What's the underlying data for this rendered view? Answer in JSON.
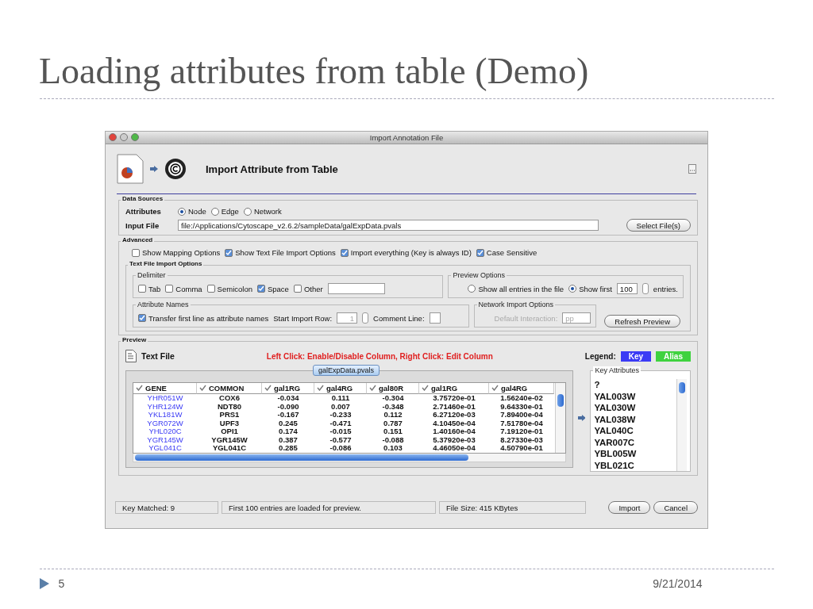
{
  "slide": {
    "title": "Loading attributes from table (Demo)",
    "page_number": "5",
    "date": "9/21/2014"
  },
  "window": {
    "title": "Import Annotation File"
  },
  "header": {
    "title": "Import Attribute from Table"
  },
  "data_sources": {
    "label": "Data Sources",
    "attributes_label": "Attributes",
    "attribute_types": [
      {
        "label": "Node",
        "selected": true
      },
      {
        "label": "Edge",
        "selected": false
      },
      {
        "label": "Network",
        "selected": false
      }
    ],
    "input_file_label": "Input File",
    "input_file": "file:/Applications/Cytoscape_v2.6.2/sampleData/galExpData.pvals",
    "select_button": "Select File(s)"
  },
  "advanced": {
    "label": "Advanced",
    "options": [
      {
        "label": "Show Mapping Options",
        "checked": false
      },
      {
        "label": "Show Text File Import Options",
        "checked": true
      },
      {
        "label": "Import everything (Key is always ID)",
        "checked": true
      },
      {
        "label": "Case Sensitive",
        "checked": true
      }
    ],
    "text_file_import_options": {
      "label": "Text File Import Options",
      "delimiter": {
        "label": "Delimiter",
        "options": [
          {
            "label": "Tab",
            "checked": false
          },
          {
            "label": "Comma",
            "checked": false
          },
          {
            "label": "Semicolon",
            "checked": false
          },
          {
            "label": "Space",
            "checked": true
          },
          {
            "label": "Other",
            "checked": false
          }
        ]
      },
      "preview_options": {
        "label": "Preview Options",
        "choices": [
          {
            "label": "Show all entries in the file",
            "selected": false
          },
          {
            "label": "Show first",
            "selected": true
          }
        ],
        "count": "100",
        "suffix": "entries."
      },
      "attribute_names": {
        "label": "Attribute Names",
        "transfer": {
          "label": "Transfer first line as attribute names",
          "checked": true
        },
        "start_row_label": "Start Import Row:",
        "start_row": "1",
        "start_row_disabled": true,
        "comment_label": "Comment Line:"
      },
      "network_import_options": {
        "label": "Network Import Options",
        "default_interaction_label": "Default Interaction:",
        "default_interaction": "pp",
        "disabled": true
      },
      "refresh_button": "Refresh Preview"
    }
  },
  "preview": {
    "label": "Preview",
    "file_type": "Text File",
    "hint": "Left Click: Enable/Disable Column, Right Click: Edit Column",
    "legend_label": "Legend:",
    "legend": [
      {
        "label": "Key",
        "color": "#3b3bf5"
      },
      {
        "label": "Alias",
        "color": "#3fd23f"
      }
    ],
    "tab": "galExpData.pvals",
    "columns": [
      "GENE",
      "COMMON",
      "gal1RG",
      "gal4RG",
      "gal80R",
      "gal1RG",
      "gal4RG"
    ],
    "rows": [
      [
        "YHR051W",
        "COX6",
        "-0.034",
        "0.111",
        "-0.304",
        "3.75720e-01",
        "1.56240e-02"
      ],
      [
        "YHR124W",
        "NDT80",
        "-0.090",
        "0.007",
        "-0.348",
        "2.71460e-01",
        "9.64330e-01"
      ],
      [
        "YKL181W",
        "PRS1",
        "-0.167",
        "-0.233",
        "0.112",
        "6.27120e-03",
        "7.89400e-04"
      ],
      [
        "YGR072W",
        "UPF3",
        "0.245",
        "-0.471",
        "0.787",
        "4.10450e-04",
        "7.51780e-04"
      ],
      [
        "YHL020C",
        "OPI1",
        "0.174",
        "-0.015",
        "0.151",
        "1.40160e-04",
        "7.19120e-01"
      ],
      [
        "YGR145W",
        "YGR145W",
        "0.387",
        "-0.577",
        "-0.088",
        "5.37920e-03",
        "8.27330e-03"
      ],
      [
        "YGL041C",
        "YGL041C",
        "0.285",
        "-0.086",
        "0.103",
        "4.46050e-04",
        "4.50790e-01"
      ]
    ],
    "key_attributes": {
      "label": "Key Attributes",
      "items": [
        "?",
        "YAL003W",
        "YAL030W",
        "YAL038W",
        "YAL040C",
        "YAR007C",
        "YBL005W",
        "YBL021C"
      ]
    }
  },
  "status_bar": {
    "key_matched": "Key Matched: 9",
    "message": "First 100 entries are loaded for preview.",
    "file_size": "File Size: 415 KBytes"
  },
  "buttons": [
    "Import",
    "Cancel"
  ]
}
